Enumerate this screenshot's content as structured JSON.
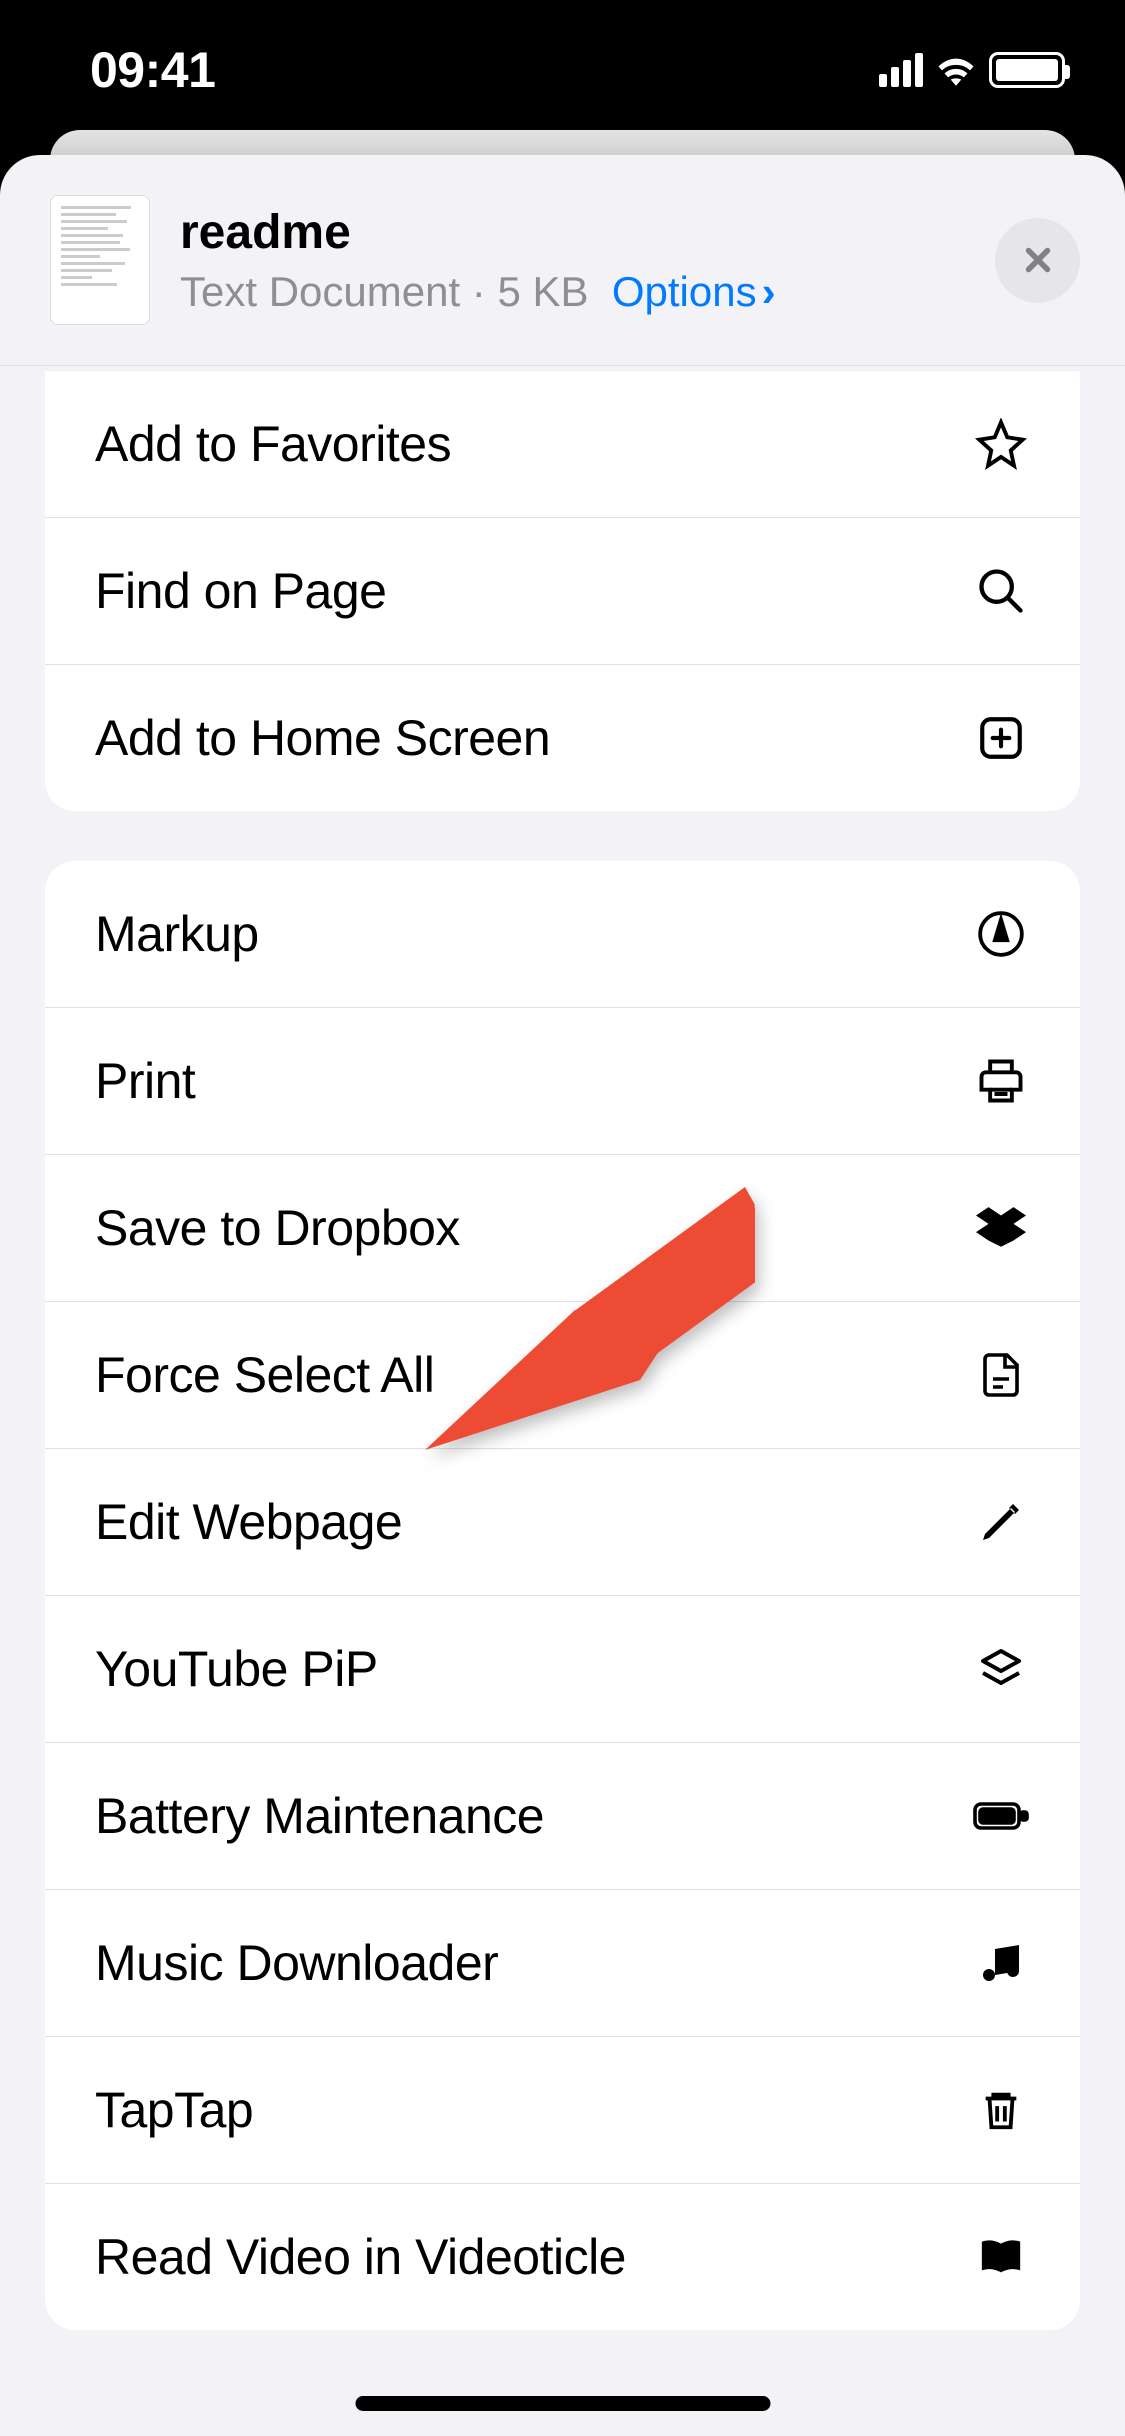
{
  "status": {
    "time": "09:41"
  },
  "header": {
    "title": "readme",
    "subtitle_type": "Text Document",
    "subtitle_size": "5 KB",
    "options_label": "Options"
  },
  "sections": [
    {
      "partialTop": true,
      "items": [
        {
          "label": "Add to Favorites",
          "icon": "star",
          "name": "action-add-favorites"
        },
        {
          "label": "Find on Page",
          "icon": "search",
          "name": "action-find-on-page"
        },
        {
          "label": "Add to Home Screen",
          "icon": "plus-square",
          "name": "action-add-home-screen"
        }
      ]
    },
    {
      "partialTop": false,
      "items": [
        {
          "label": "Markup",
          "icon": "markup",
          "name": "action-markup"
        },
        {
          "label": "Print",
          "icon": "print",
          "name": "action-print"
        },
        {
          "label": "Save to Dropbox",
          "icon": "dropbox",
          "name": "action-save-dropbox"
        },
        {
          "label": "Force Select All",
          "icon": "doc",
          "name": "action-force-select-all"
        },
        {
          "label": "Edit Webpage",
          "icon": "pencil",
          "name": "action-edit-webpage"
        },
        {
          "label": "YouTube PiP",
          "icon": "layers",
          "name": "action-youtube-pip"
        },
        {
          "label": "Battery Maintenance",
          "icon": "battery",
          "name": "action-battery-maintenance"
        },
        {
          "label": "Music Downloader",
          "icon": "music",
          "name": "action-music-downloader"
        },
        {
          "label": "TapTap",
          "icon": "trash",
          "name": "action-taptap"
        },
        {
          "label": "Read Video in Videoticle",
          "icon": "book",
          "name": "action-read-videoticle"
        }
      ]
    }
  ],
  "annotation": {
    "color": "#ed4b34"
  }
}
